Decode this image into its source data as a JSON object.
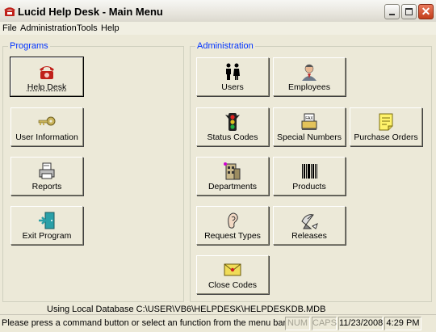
{
  "window": {
    "title": "Lucid Help Desk - Main Menu",
    "controls": {
      "minimize": "minimize-icon",
      "maximize": "maximize-icon",
      "close": "close-icon"
    }
  },
  "menu": [
    "File",
    "Administration",
    "Tools",
    "Help"
  ],
  "programs": {
    "label": "Programs",
    "buttons": [
      {
        "label": "Help Desk",
        "icon": "telephone-icon",
        "focused": true
      },
      {
        "label": "User Information",
        "icon": "key-icon"
      },
      {
        "label": "Reports",
        "icon": "printer-icon"
      },
      {
        "label": "Exit Program",
        "icon": "exit-door-icon"
      }
    ]
  },
  "administration": {
    "label": "Administration",
    "buttons": [
      {
        "label": "Users",
        "icon": "people-icon"
      },
      {
        "label": "Employees",
        "icon": "employee-icon"
      },
      {
        "label": "Status Codes",
        "icon": "traffic-light-icon"
      },
      {
        "label": "Special Numbers",
        "icon": "fax-icon"
      },
      {
        "label": "Purchase Orders",
        "icon": "note-icon"
      },
      {
        "label": "Departments",
        "icon": "building-icon"
      },
      {
        "label": "Products",
        "icon": "barcode-icon"
      },
      {
        "label": "Request Types",
        "icon": "ear-icon"
      },
      {
        "label": "Releases",
        "icon": "satellite-dish-icon"
      },
      {
        "label": "Close Codes",
        "icon": "envelope-icon"
      }
    ]
  },
  "database_line": "Using Local Database  C:\\USER\\VB6\\HELPDESK\\HELPDESKDB.MDB",
  "status": {
    "message": "Please press a command button or select an function from the menu bar",
    "num": "NUM",
    "caps": "CAPS",
    "date": "11/23/2008",
    "time": "4:29 PM"
  },
  "colors": {
    "frame_label": "#0033ff",
    "close_button": "#c23e1b",
    "face": "#ece9d8"
  }
}
